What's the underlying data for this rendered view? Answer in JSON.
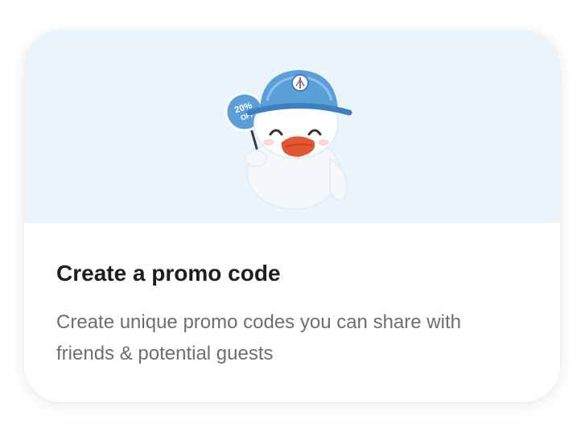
{
  "card": {
    "title": "Create a promo code",
    "description": "Create unique promo codes you can share with friends & potential guests",
    "illustration": {
      "icon": "duck-mascot-with-sign-icon",
      "sign_text_line1": "20%",
      "sign_text_line2": "OFF"
    }
  },
  "colors": {
    "hero_background": "#e9f4fd",
    "helmet_blue": "#5b9fd8",
    "beak_orange": "#e2572f",
    "title_text": "#1e1e1e",
    "description_text": "#6e6e6e"
  }
}
